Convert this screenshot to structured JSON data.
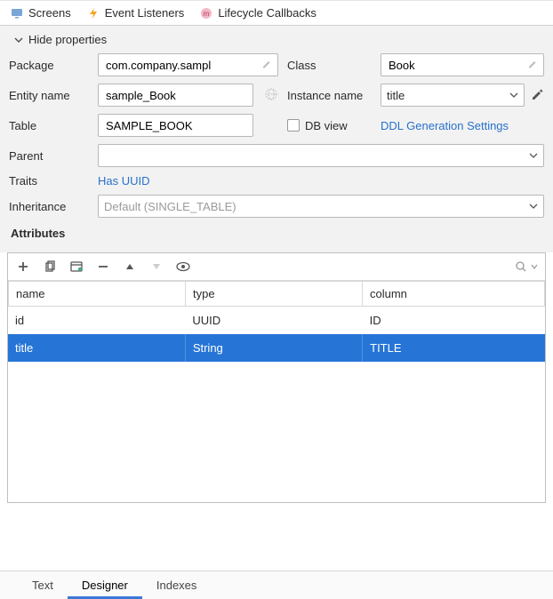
{
  "topTabs": {
    "screens": "Screens",
    "eventListeners": "Event Listeners",
    "lifecycle": "Lifecycle Callbacks"
  },
  "hideProperties": "Hide properties",
  "labels": {
    "package": "Package",
    "class": "Class",
    "entityName": "Entity name",
    "instanceName": "Instance name",
    "table": "Table",
    "dbView": "DB view",
    "ddlLink": "DDL Generation Settings",
    "parent": "Parent",
    "traits": "Traits",
    "inheritance": "Inheritance",
    "attributes": "Attributes"
  },
  "values": {
    "package": "com.company.sampl",
    "class": "Book",
    "entityName": "sample_Book",
    "instanceName": "title",
    "table": "SAMPLE_BOOK",
    "parent": "",
    "traits": "Has UUID",
    "inheritancePlaceholder": "Default (SINGLE_TABLE)"
  },
  "attrTable": {
    "headers": {
      "name": "name",
      "type": "type",
      "column": "column"
    },
    "rows": [
      {
        "name": "id",
        "type": "UUID",
        "column": "ID",
        "selected": false
      },
      {
        "name": "title",
        "type": "String",
        "column": "TITLE",
        "selected": true
      }
    ]
  },
  "bottomTabs": {
    "text": "Text",
    "designer": "Designer",
    "indexes": "Indexes"
  }
}
